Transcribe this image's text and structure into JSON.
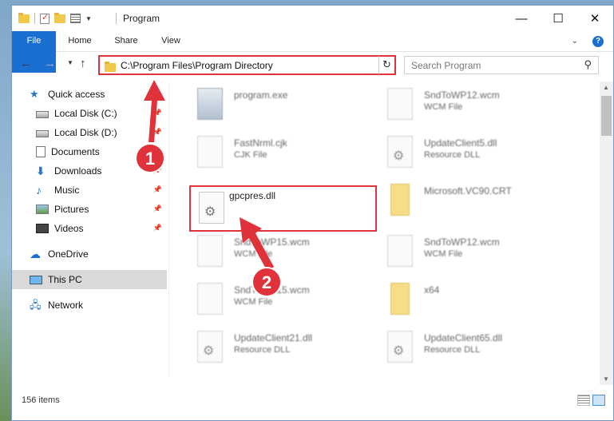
{
  "window": {
    "title": "Program",
    "controls": {
      "minimize": "—",
      "maximize": "☐",
      "close": "✕"
    }
  },
  "ribbon": {
    "tabs": [
      "File",
      "Home",
      "Share",
      "View"
    ]
  },
  "nav": {
    "address": "C:\\Program Files\\Program Directory",
    "search_placeholder": "Search Program"
  },
  "sidebar": {
    "items": [
      {
        "label": "Quick access",
        "icon": "star-icon",
        "pinned": false
      },
      {
        "label": "Local Disk (C:)",
        "icon": "disk-icon",
        "pinned": true
      },
      {
        "label": "Local Disk (D:)",
        "icon": "disk-icon",
        "pinned": true
      },
      {
        "label": "Documents",
        "icon": "documents-icon",
        "pinned": true
      },
      {
        "label": "Downloads",
        "icon": "downloads-icon",
        "pinned": true
      },
      {
        "label": "Music",
        "icon": "music-icon",
        "pinned": true
      },
      {
        "label": "Pictures",
        "icon": "pictures-icon",
        "pinned": true
      },
      {
        "label": "Videos",
        "icon": "videos-icon",
        "pinned": true
      },
      {
        "label": "OneDrive",
        "icon": "onedrive-icon",
        "pinned": false
      },
      {
        "label": "This PC",
        "icon": "pc-icon",
        "pinned": false,
        "selected": true
      },
      {
        "label": "Network",
        "icon": "network-icon",
        "pinned": false
      }
    ]
  },
  "files": [
    {
      "name": "program.exe",
      "type": "",
      "icon": "exe-icon"
    },
    {
      "name": "SndToWP12.wcm",
      "type": "WCM File",
      "icon": "file-icon"
    },
    {
      "name": "FastNrml.cjk",
      "type": "CJK File",
      "icon": "file-icon"
    },
    {
      "name": "UpdateClient5.dll",
      "type": "Resource DLL",
      "icon": "dll-icon"
    },
    {
      "name": "gpcpres.dll",
      "type": "",
      "icon": "dll-icon"
    },
    {
      "name": "Microsoft.VC90.CRT",
      "type": "",
      "icon": "folder-icon"
    },
    {
      "name": "SndToWP15.wcm",
      "type": "WCM File",
      "icon": "file-icon"
    },
    {
      "name": "SndToWP12.wcm",
      "type": "WCM File",
      "icon": "file-icon"
    },
    {
      "name": "SndToWP15.wcm",
      "type": "WCM File",
      "icon": "file-icon"
    },
    {
      "name": "x64",
      "type": "",
      "icon": "folder-icon"
    },
    {
      "name": "UpdateClient21.dll",
      "type": "Resource DLL",
      "icon": "dll-icon"
    },
    {
      "name": "UpdateClient65.dll",
      "type": "Resource DLL",
      "icon": "dll-icon"
    }
  ],
  "status": {
    "item_count": "156 items"
  },
  "annotations": {
    "step1": "1",
    "step2": "2",
    "color": "#e0323a"
  }
}
